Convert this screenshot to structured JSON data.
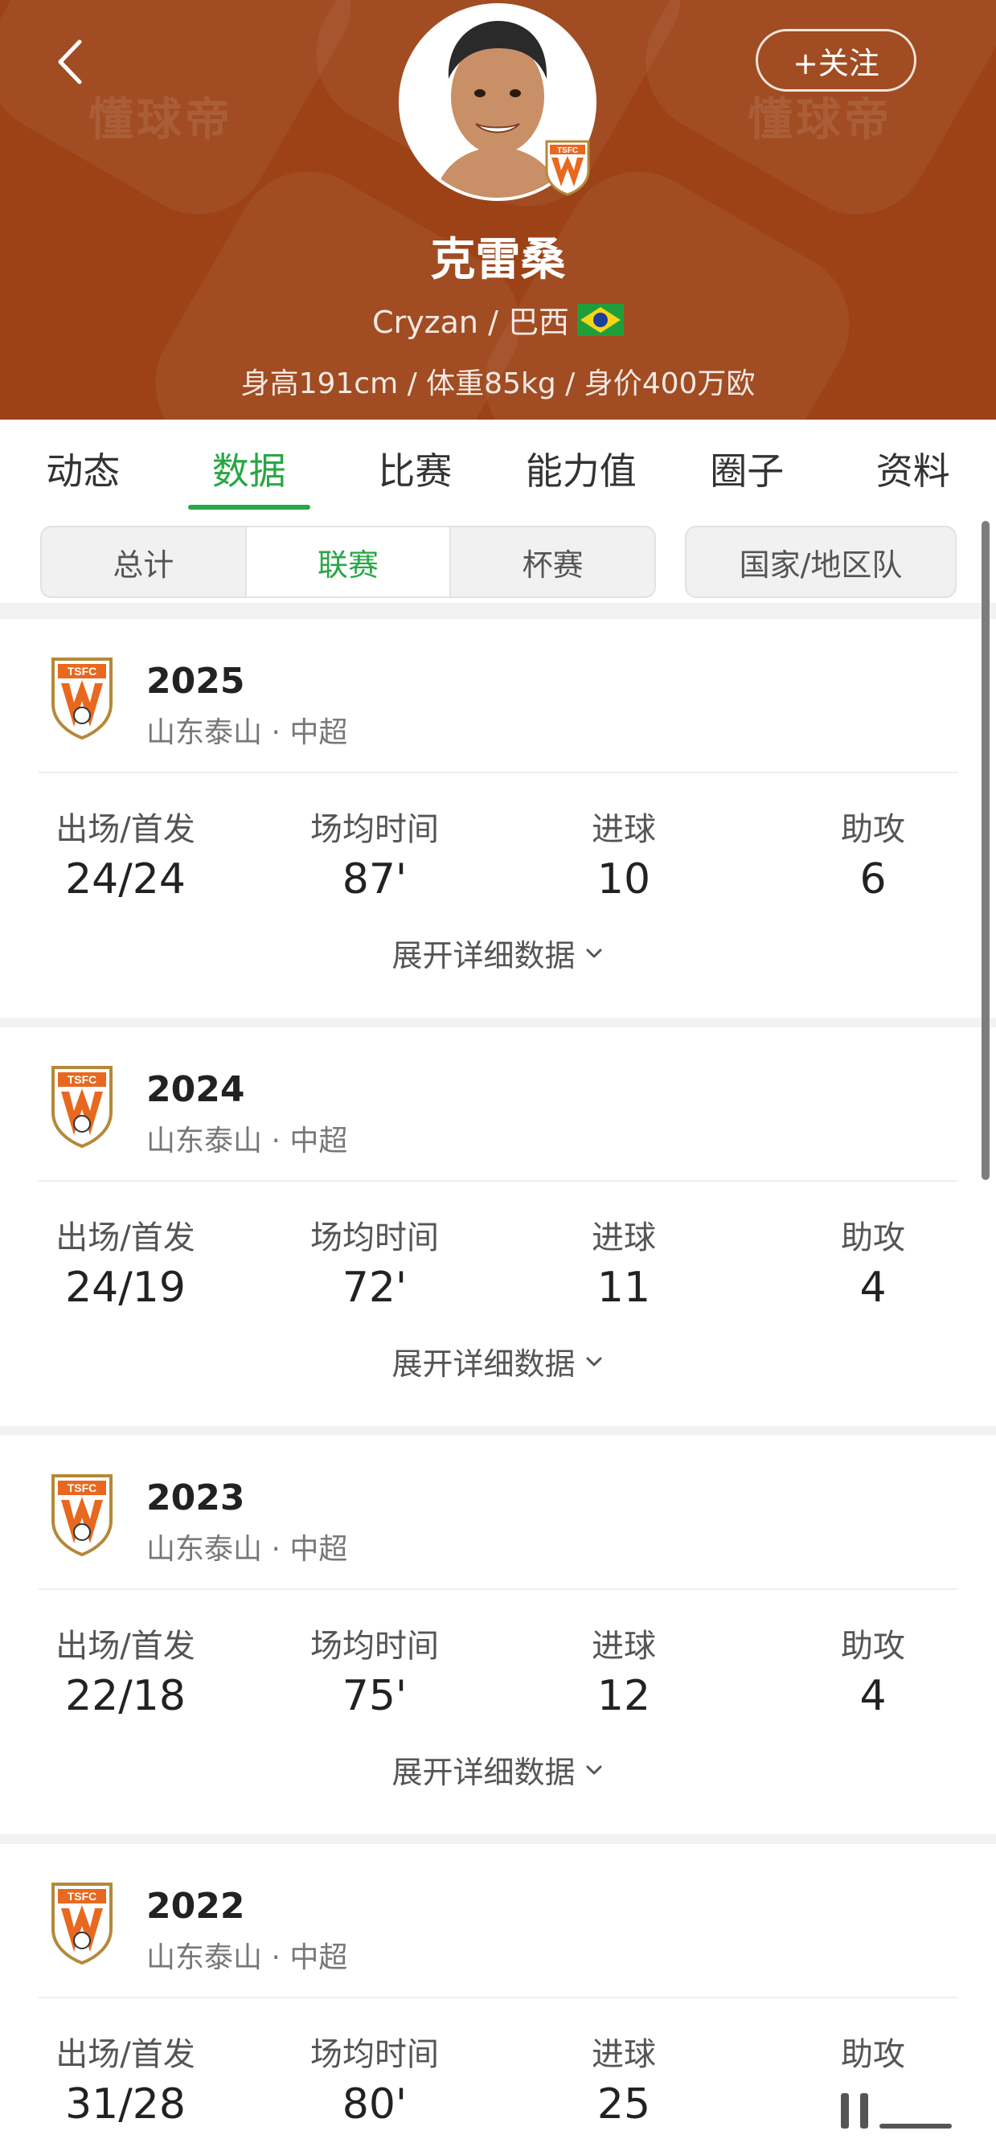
{
  "header": {
    "watermark": "懂球帝",
    "follow_label": "+关注",
    "player_name": "克雷桑",
    "player_subtitle": "Cryzan / 巴西",
    "player_stats": "身高191cm / 体重85kg / 身价400万欧",
    "flag_icon": "brazil-flag-icon",
    "badge_icon": "tsfc-badge-icon"
  },
  "tabs": [
    "动态",
    "数据",
    "比赛",
    "能力值",
    "圈子",
    "资料"
  ],
  "active_tab": "数据",
  "filters": {
    "segments": [
      "总计",
      "联赛",
      "杯赛"
    ],
    "active": "联赛",
    "national": "国家/地区队"
  },
  "stat_labels": {
    "apps": "出场/首发",
    "minutes": "场均时间",
    "goals": "进球",
    "assists": "助攻"
  },
  "expand_label": "展开详细数据",
  "seasons": [
    {
      "year": "2025",
      "league": "山东泰山 · 中超",
      "apps": "24/24",
      "minutes": "87'",
      "goals": "10",
      "assists": "6"
    },
    {
      "year": "2024",
      "league": "山东泰山 · 中超",
      "apps": "24/19",
      "minutes": "72'",
      "goals": "11",
      "assists": "4"
    },
    {
      "year": "2023",
      "league": "山东泰山 · 中超",
      "apps": "22/18",
      "minutes": "75'",
      "goals": "12",
      "assists": "4"
    },
    {
      "year": "2022",
      "league": "山东泰山 · 中超",
      "apps": "31/28",
      "minutes": "80'",
      "goals": "25",
      "assists": ""
    }
  ],
  "colors": {
    "header_bg": "#9c4216",
    "accent_green": "#27a745",
    "badge_orange": "#e8681f"
  }
}
